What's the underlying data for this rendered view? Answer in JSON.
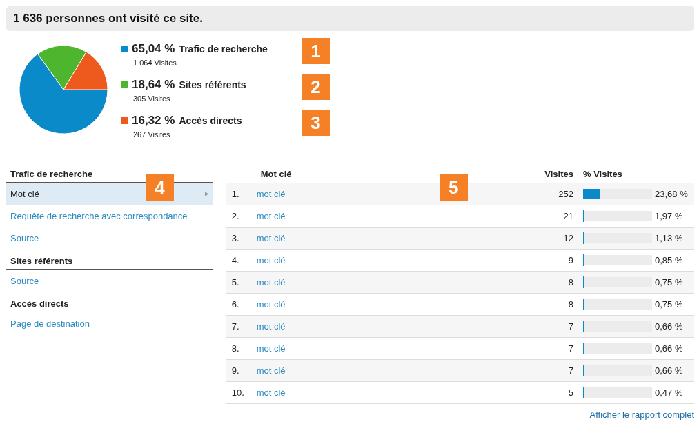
{
  "header": {
    "title": "1 636 personnes ont visité ce site."
  },
  "overview": {
    "chart_data": {
      "type": "pie",
      "values": [
        65.04,
        18.64,
        16.32
      ]
    },
    "legend": [
      {
        "percent": "65,04 %",
        "label": "Trafic de recherche",
        "visits": "1 064 Visites",
        "color": "#0a8ac9",
        "callout": "1"
      },
      {
        "percent": "18,64 %",
        "label": "Sites référents",
        "visits": "305 Visites",
        "color": "#4db52e",
        "callout": "2"
      },
      {
        "percent": "16,32 %",
        "label": "Accès directs",
        "visits": "267 Visites",
        "color": "#ee5a1e",
        "callout": "3"
      }
    ]
  },
  "nav": {
    "callout": "4",
    "sections": [
      {
        "title": "Trafic de recherche",
        "items": [
          {
            "label": "Mot clé",
            "selected": true
          },
          {
            "label": "Requête de recherche avec correspondance",
            "selected": false
          },
          {
            "label": "Source",
            "selected": false
          }
        ]
      },
      {
        "title": "Sites référents",
        "items": [
          {
            "label": "Source",
            "selected": false
          }
        ]
      },
      {
        "title": "Accès directs",
        "items": [
          {
            "label": "Page de destination",
            "selected": false
          }
        ]
      }
    ]
  },
  "table": {
    "callout": "5",
    "columns": [
      "Mot clé",
      "Visites",
      "% Visites"
    ],
    "rows": [
      {
        "rank": "1.",
        "keyword": "mot clé",
        "visits": "252",
        "level": 0.2368,
        "percent": "23,68 %"
      },
      {
        "rank": "2.",
        "keyword": "mot clé",
        "visits": "21",
        "level": 0.0197,
        "percent": "1,97 %"
      },
      {
        "rank": "3.",
        "keyword": "mot clé",
        "visits": "12",
        "level": 0.0113,
        "percent": "1,13 %"
      },
      {
        "rank": "4.",
        "keyword": "mot clé",
        "visits": "9",
        "level": 0.0085,
        "percent": "0,85 %"
      },
      {
        "rank": "5.",
        "keyword": "mot clé",
        "visits": "8",
        "level": 0.0075,
        "percent": "0,75 %"
      },
      {
        "rank": "6.",
        "keyword": "mot clé",
        "visits": "8",
        "level": 0.0075,
        "percent": "0,75 %"
      },
      {
        "rank": "7.",
        "keyword": "mot clé",
        "visits": "7",
        "level": 0.0066,
        "percent": "0,66 %"
      },
      {
        "rank": "8.",
        "keyword": "mot clé",
        "visits": "7",
        "level": 0.0066,
        "percent": "0,66 %"
      },
      {
        "rank": "9.",
        "keyword": "mot clé",
        "visits": "7",
        "level": 0.0066,
        "percent": "0,66 %"
      },
      {
        "rank": "10.",
        "keyword": "mot clé",
        "visits": "5",
        "level": 0.0047,
        "percent": "0,47 %"
      }
    ],
    "footer_link": "Afficher le rapport complet"
  }
}
